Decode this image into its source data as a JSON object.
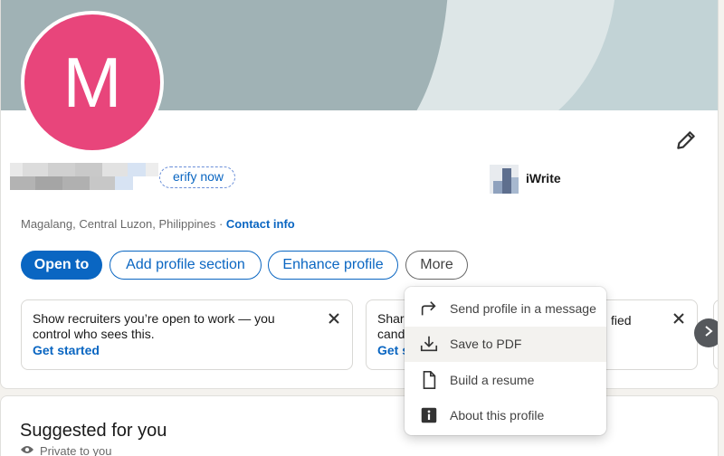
{
  "profile": {
    "avatar_letter": "M",
    "verify_label": "erify now",
    "company": "iWrite",
    "location": "Magalang, Central Luzon, Philippines",
    "location_sep": " · ",
    "contact_info": "Contact info"
  },
  "actions": {
    "open_to": "Open to",
    "add_section": "Add profile section",
    "enhance": "Enhance profile",
    "more": "More"
  },
  "promos": [
    {
      "text": "Show recruiters you’re open to work — you control who sees this.",
      "link": "Get started"
    },
    {
      "text": "Share",
      "text2": "candi",
      "tail": "fied",
      "link": "Get s"
    }
  ],
  "more_menu": {
    "items": [
      {
        "label": "Send profile in a message",
        "icon": "share-arrow-icon"
      },
      {
        "label": "Save to PDF",
        "icon": "download-icon"
      },
      {
        "label": "Build a resume",
        "icon": "document-icon"
      },
      {
        "label": "About this profile",
        "icon": "info-icon"
      }
    ]
  },
  "suggested": {
    "title": "Suggested for you",
    "privacy": "Private to you"
  },
  "colors": {
    "brand_blue": "#0a66c2",
    "avatar_bg": "#e8457b",
    "banner": "#a0b2b5"
  }
}
